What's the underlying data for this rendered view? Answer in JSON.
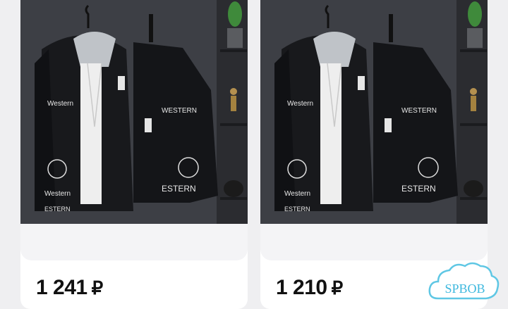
{
  "products": [
    {
      "price": "1 241",
      "currency": "₽"
    },
    {
      "price": "1 210",
      "currency": "₽"
    }
  ],
  "watermark": {
    "text": "SPBOB"
  },
  "colors": {
    "accent_watermark": "#5fc7e4",
    "photo_bg": "#3b3d43",
    "jacket": "#16171a"
  }
}
